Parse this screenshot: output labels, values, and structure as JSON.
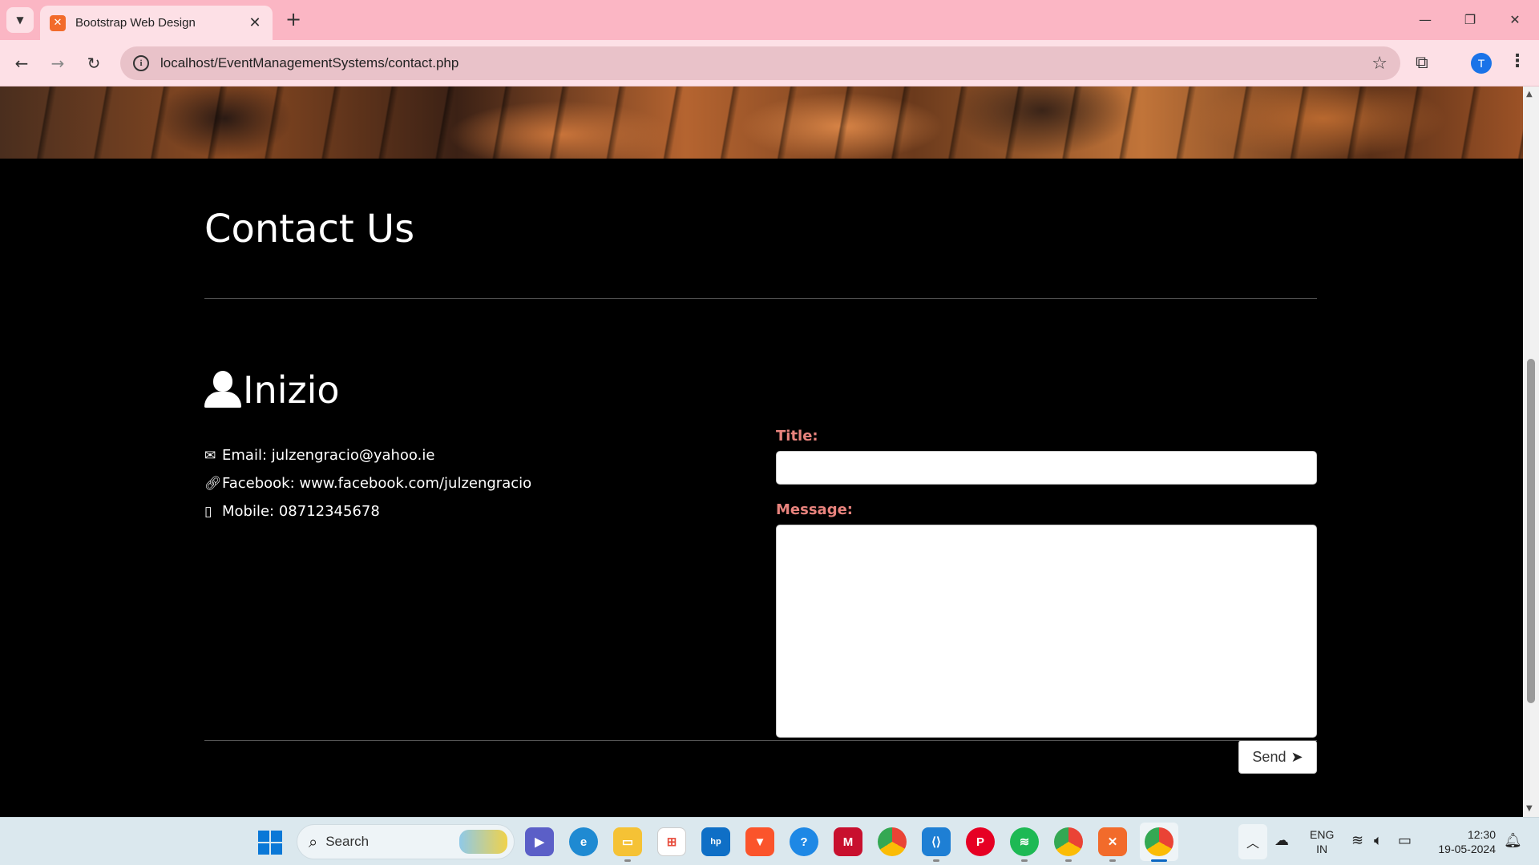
{
  "browser": {
    "tab_title": "Bootstrap Web Design",
    "tab_close": "✕",
    "new_tab": "+",
    "url": "localhost/EventManagementSystems/contact.php",
    "profile_initial": "T",
    "window_controls": {
      "minimize": "—",
      "restore": "❐",
      "close": "✕"
    }
  },
  "page": {
    "title": "Contact Us",
    "org_name": "Inizio",
    "contact": {
      "email": "Email: julzengracio@yahoo.ie",
      "facebook": "Facebook: www.facebook.com/julzengracio",
      "mobile": "Mobile: 08712345678"
    },
    "form": {
      "title_label": "Title:",
      "title_value": "",
      "message_label": "Message:",
      "message_value": "",
      "send_label": "Send"
    }
  },
  "taskbar": {
    "search_placeholder": "Search",
    "apps": [
      "teams-meet",
      "edge",
      "file-explorer",
      "microsoft-store",
      "myhp",
      "brave",
      "help",
      "mcafee",
      "chrome",
      "vscode",
      "pinterest",
      "spotify",
      "chrome-profile",
      "xampp",
      "chrome-active"
    ],
    "lang_line1": "ENG",
    "lang_line2": "IN",
    "time": "12:30",
    "date": "19-05-2024"
  },
  "colors": {
    "tab_bar": "#fbb6c4",
    "toolbar": "#fde0e6",
    "page_bg": "#000000",
    "form_label": "#e8837d",
    "taskbar": "#dbe8ee"
  }
}
